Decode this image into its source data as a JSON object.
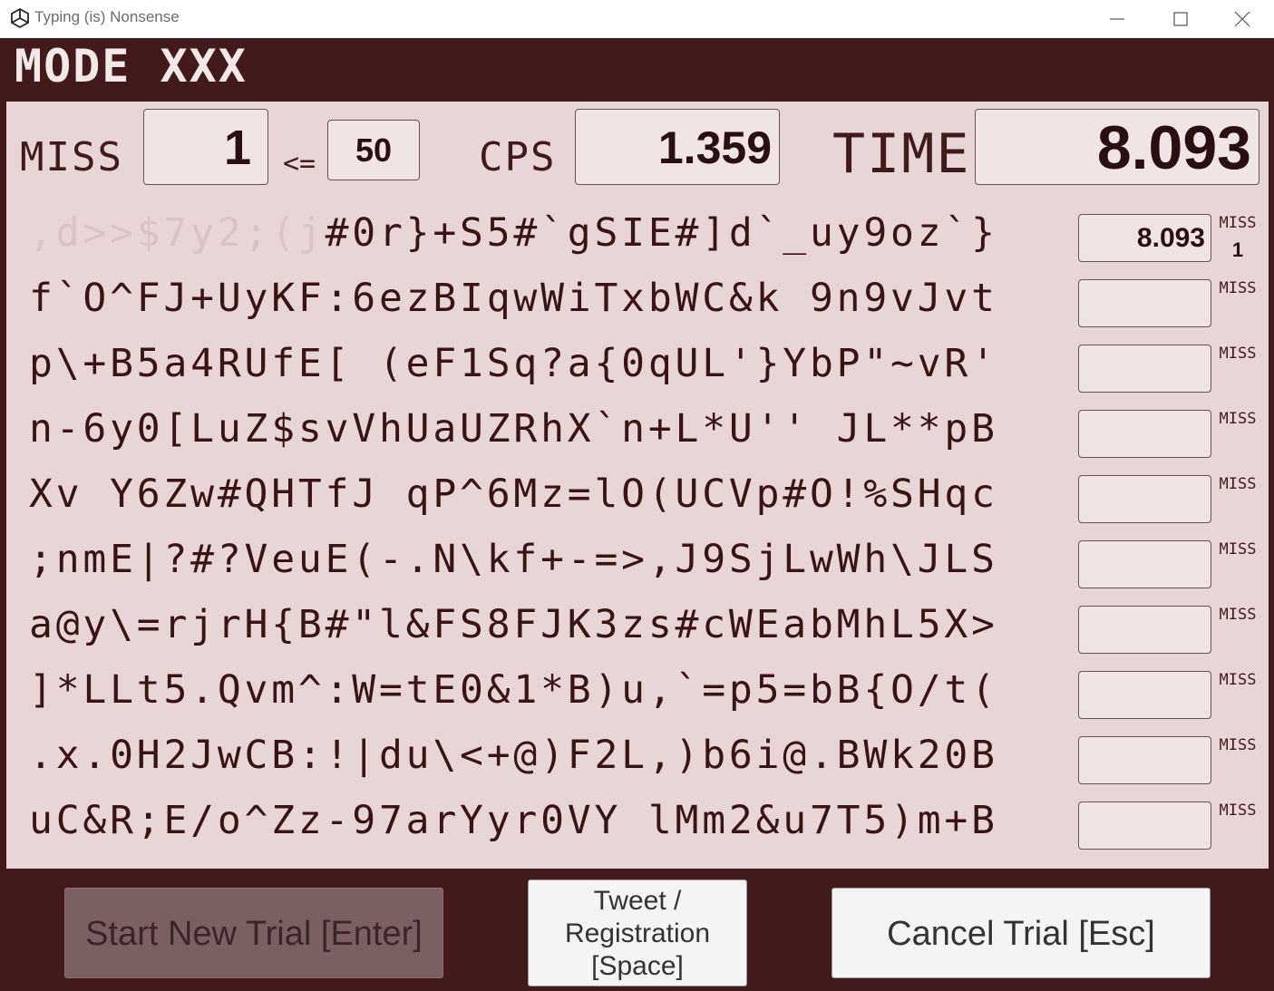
{
  "window": {
    "title": "Typing (is) Nonsense"
  },
  "mode": {
    "title": "MODE XXX"
  },
  "stats": {
    "miss_label": "MISS",
    "miss_value": "1",
    "limit_op": "<=",
    "limit_value": "50",
    "cps_label": "CPS",
    "cps_value": "1.359",
    "time_label": "TIME",
    "time_value": "8.093"
  },
  "rows": [
    {
      "typed": ",d>>$7y2;(j",
      "remaining": "#0r}+S5#`gSIE#]d`_uy9oz`}",
      "time": "8.093",
      "miss_label": "MISS",
      "miss_count": "1"
    },
    {
      "typed": "",
      "remaining": "f`O^FJ+UyKF:6ezBIqwWiTxbWC&k 9n9vJvt",
      "time": "",
      "miss_label": "MISS",
      "miss_count": ""
    },
    {
      "typed": "",
      "remaining": "p\\+B5a4RUfE[ (eF1Sq?a{0qUL'}YbP\"~vR'",
      "time": "",
      "miss_label": "MISS",
      "miss_count": ""
    },
    {
      "typed": "",
      "remaining": "n-6y0[LuZ$svVhUaUZRhX`n+L*U'' JL**pB",
      "time": "",
      "miss_label": "MISS",
      "miss_count": ""
    },
    {
      "typed": "",
      "remaining": "Xv Y6Zw#QHTfJ qP^6Mz=lO(UCVp#O!%SHqc",
      "time": "",
      "miss_label": "MISS",
      "miss_count": ""
    },
    {
      "typed": "",
      "remaining": ";nmE|?#?VeuE(-.N\\kf+-=>,J9SjLwWh\\JLS",
      "time": "",
      "miss_label": "MISS",
      "miss_count": ""
    },
    {
      "typed": "",
      "remaining": "a@y\\=rjrH{B#\"l&FS8FJK3zs#cWEabMhL5X>",
      "time": "",
      "miss_label": "MISS",
      "miss_count": ""
    },
    {
      "typed": "",
      "remaining": "]*LLt5.Qvm^:W=tE0&1*B)u,`=p5=bB{O/t(",
      "time": "",
      "miss_label": "MISS",
      "miss_count": ""
    },
    {
      "typed": "",
      "remaining": ".x.0H2JwCB:!|du\\<+@)F2L,)b6i@.BWk20B",
      "time": "",
      "miss_label": "MISS",
      "miss_count": ""
    },
    {
      "typed": "",
      "remaining": "uC&R;E/o^Zz-97arYyr0VY lMm2&u7T5)m+B",
      "time": "",
      "miss_label": "MISS",
      "miss_count": ""
    }
  ],
  "buttons": {
    "start": "Start New Trial [Enter]",
    "tweet_line1": "Tweet /",
    "tweet_line2": "Registration",
    "tweet_line3": "[Space]",
    "cancel": "Cancel Trial [Esc]"
  },
  "colors": {
    "background": "#421a1c",
    "panel": "#e8d6d6",
    "text": "#3a1315",
    "typed": "#d9c4c4"
  }
}
